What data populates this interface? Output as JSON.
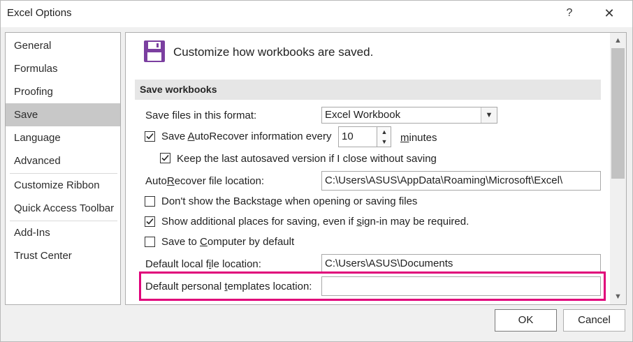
{
  "window": {
    "title": "Excel Options",
    "help_label": "?",
    "close_label": "✕"
  },
  "sidebar": {
    "items": [
      {
        "label": "General"
      },
      {
        "label": "Formulas"
      },
      {
        "label": "Proofing"
      },
      {
        "label": "Save",
        "active": true
      },
      {
        "label": "Language"
      },
      {
        "label": "Advanced"
      },
      {
        "label": "Customize Ribbon"
      },
      {
        "label": "Quick Access Toolbar"
      },
      {
        "label": "Add-Ins"
      },
      {
        "label": "Trust Center"
      }
    ]
  },
  "main": {
    "header": "Customize how workbooks are saved.",
    "section_title": "Save workbooks",
    "format": {
      "label_pre": "Save files in this format:",
      "value": "Excel Workbook"
    },
    "autorecover": {
      "label_pre": "Save ",
      "label_u": "A",
      "label_post": "utoRecover information every",
      "checked": true,
      "minutes_value": "10",
      "minutes_u": "m",
      "minutes_post": "inutes"
    },
    "keep_last": {
      "label": "Keep the last autosaved version if I close without saving",
      "checked": true
    },
    "autorecover_location": {
      "label_pre": "Auto",
      "label_u": "R",
      "label_post": "ecover file location:",
      "value": "C:\\Users\\ASUS\\AppData\\Roaming\\Microsoft\\Excel\\"
    },
    "dont_show_backstage": {
      "label": "Don't show the Backstage when opening or saving files",
      "checked": false
    },
    "show_additional": {
      "label_pre": "Show additional places for saving, even if ",
      "label_u": "s",
      "label_post": "ign-in may be required.",
      "checked": true
    },
    "save_to_computer": {
      "label_pre": "Save to ",
      "label_u": "C",
      "label_post": "omputer by default",
      "checked": false
    },
    "default_local": {
      "label_pre": "Default local f",
      "label_u": "i",
      "label_post": "le location:",
      "value": "C:\\Users\\ASUS\\Documents"
    },
    "templates_location": {
      "label_pre": "Default personal ",
      "label_u": "t",
      "label_post": "emplates location:",
      "value": ""
    }
  },
  "footer": {
    "ok_label": "OK",
    "cancel_label": "Cancel"
  },
  "colors": {
    "highlight": "#e0007a",
    "icon_purple": "#7b3fa0",
    "active_nav": "#c8c8c8"
  }
}
